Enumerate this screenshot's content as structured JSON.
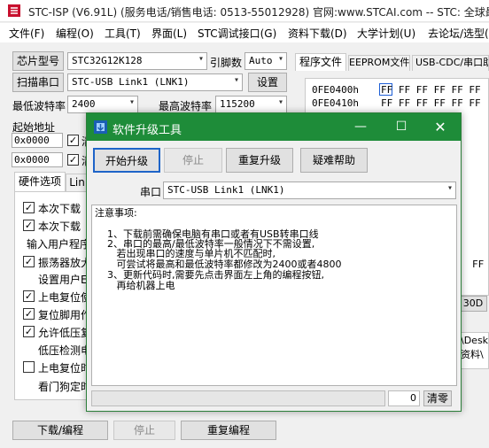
{
  "app": {
    "title": "STC-ISP (V6.91L) (服务电话/销售电话: 0513-55012928) 官网:www.STCAI.com  -- STC: 全球最大"
  },
  "menu": [
    "文件(F)",
    "编程(O)",
    "工具(T)",
    "界面(L)",
    "STC调试接口(G)",
    "资料下载(D)",
    "大学计划(U)",
    "去论坛/选型(W)"
  ],
  "left": {
    "chip_btn": "芯片型号",
    "chip_value": "STC32G12K128",
    "pins_label": "引脚数",
    "pins_value": "Auto",
    "scan_btn": "扫描串口",
    "port_value": "STC-USB Link1 (LNK1)",
    "settings_btn": "设置",
    "min_baud_label": "最低波特率",
    "min_baud_value": "2400",
    "max_baud_label": "最高波特率",
    "max_baud_value": "115200",
    "start_addr_label": "起始地址",
    "addr1": "0x0000",
    "addr2": "0x0000",
    "chk_a": "清",
    "chk_b": "清",
    "tab_hw": "硬件选项",
    "tab_link": "Lin",
    "options": [
      {
        "checked": true,
        "label": "本次下载"
      },
      {
        "checked": true,
        "label": "本次下载"
      },
      {
        "checked": null,
        "label": "输入用户程序"
      },
      {
        "checked": true,
        "label": "振荡器放大"
      },
      {
        "checked": null,
        "label": "设置用户EE"
      },
      {
        "checked": true,
        "label": "上电复位使"
      },
      {
        "checked": true,
        "label": "复位脚用作"
      },
      {
        "checked": true,
        "label": "允许低压复"
      },
      {
        "checked": null,
        "label": "低压检测电"
      },
      {
        "checked": false,
        "label": "上电复位时"
      },
      {
        "checked": null,
        "label": "看门狗定时"
      }
    ],
    "download_btn": "下载/编程",
    "stop_btn": "停止",
    "reprog_btn": "重复编程"
  },
  "right": {
    "tabs": [
      "程序文件",
      "EEPROM文件",
      "USB-CDC/串口助手"
    ],
    "rows": [
      {
        "addr": "0FE0400h",
        "bytes": "FF FF FF FF FF FF"
      },
      {
        "addr": "0FE0410h",
        "bytes": "FF FF FF FF FF FF"
      }
    ],
    "right_ff": "FF",
    "btn_30d": "30D",
    "path1": "\\Desk",
    "path2": "资料\\"
  },
  "dialog": {
    "title": "软件升级工具",
    "start_btn": "开始升级",
    "stop_btn": "停止",
    "repeat_btn": "重复升级",
    "help_btn": "疑难帮助",
    "port_label": "串口",
    "port_value": "STC-USB Link1 (LNK1)",
    "notes": [
      "注意事项:",
      "",
      "    1、下载前需确保电脑有串口或者有USB转串口线",
      "    2、串口的最高/最低波特率一般情况下不需设置,",
      "       若出现串口的速度与单片机不匹配时,",
      "       可尝试将最高和最低波特率都修改为2400或者4800",
      "    3、更新代码时,需要先点击界面左上角的编程按钮,",
      "       再给机器上电"
    ],
    "counter": "0",
    "clear_btn": "清零",
    "accent": "#1e8c39"
  }
}
